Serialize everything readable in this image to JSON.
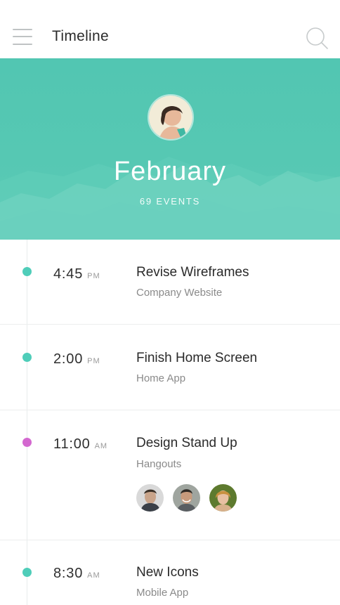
{
  "header": {
    "title": "Timeline",
    "menu_icon": "hamburger-menu-icon",
    "search_icon": "search-icon"
  },
  "hero": {
    "month": "February",
    "events_count": "69 EVENTS",
    "background_color": "#56c8b3"
  },
  "events": [
    {
      "time": "4:45",
      "ampm": "PM",
      "title": "Revise Wireframes",
      "subtitle": "Company Website",
      "dot_color": "#4fcdb9"
    },
    {
      "time": "2:00",
      "ampm": "PM",
      "title": "Finish Home Screen",
      "subtitle": "Home App",
      "dot_color": "#4fcdb9"
    },
    {
      "time": "11:00",
      "ampm": "AM",
      "title": "Design Stand Up",
      "subtitle": "Hangouts",
      "dot_color": "#d368cf",
      "attendees": [
        "attendee-avatar",
        "attendee-avatar",
        "attendee-avatar"
      ]
    },
    {
      "time": "8:30",
      "ampm": "AM",
      "title": "New Icons",
      "subtitle": "Mobile App",
      "dot_color": "#4fcdb9"
    }
  ]
}
